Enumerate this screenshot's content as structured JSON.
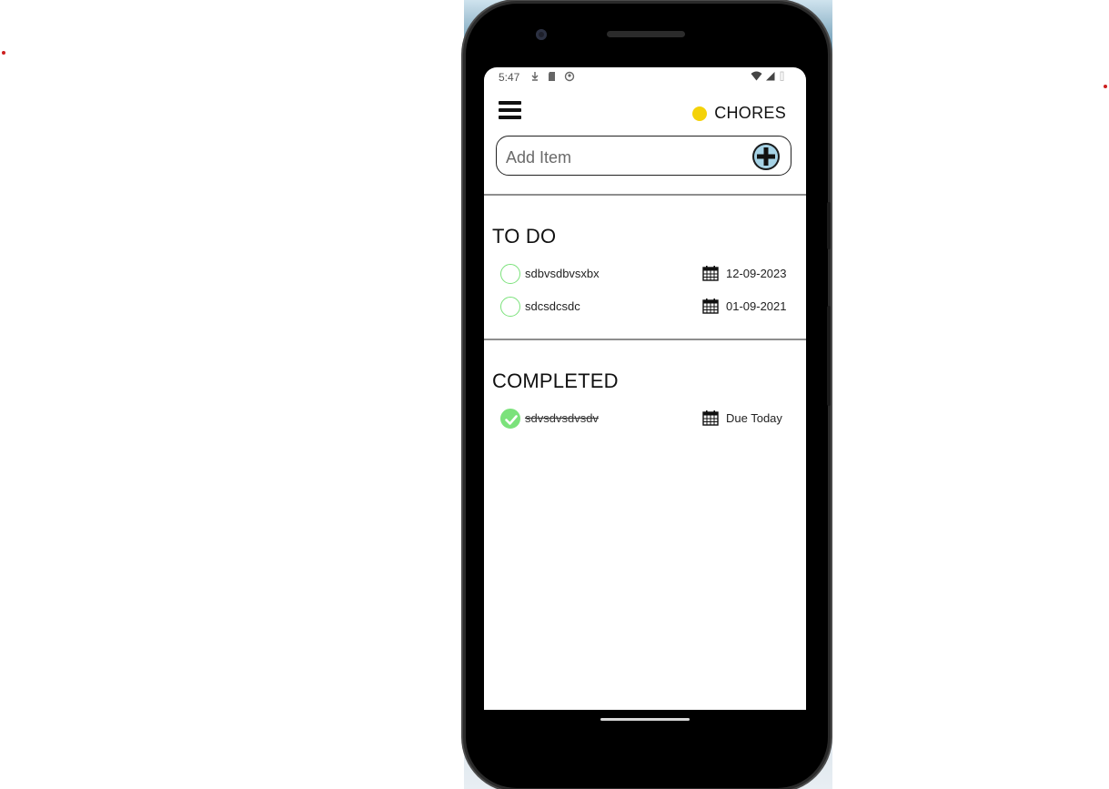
{
  "status_bar": {
    "time": "5:47"
  },
  "header": {
    "menu_icon": "hamburger-menu-icon",
    "list_name": "CHORES",
    "list_color": "#f4d209"
  },
  "add_item": {
    "placeholder": "Add Item",
    "value": "",
    "add_icon": "plus-circle-icon"
  },
  "sections": {
    "todo": {
      "title": "TO DO",
      "tasks": [
        {
          "name": "sdbvsdbvsxbx",
          "due": "12-09-2023",
          "completed": false
        },
        {
          "name": "sdcsdcsdc",
          "due": "01-09-2021",
          "completed": false
        }
      ]
    },
    "completed": {
      "title": "COMPLETED",
      "tasks": [
        {
          "name": "sdvsdvsdvsdv",
          "due": "Due Today",
          "completed": true
        }
      ]
    }
  },
  "colors": {
    "check_green": "#7be27b",
    "add_button": "#a6d3e6",
    "accent_yellow": "#f4d209"
  }
}
